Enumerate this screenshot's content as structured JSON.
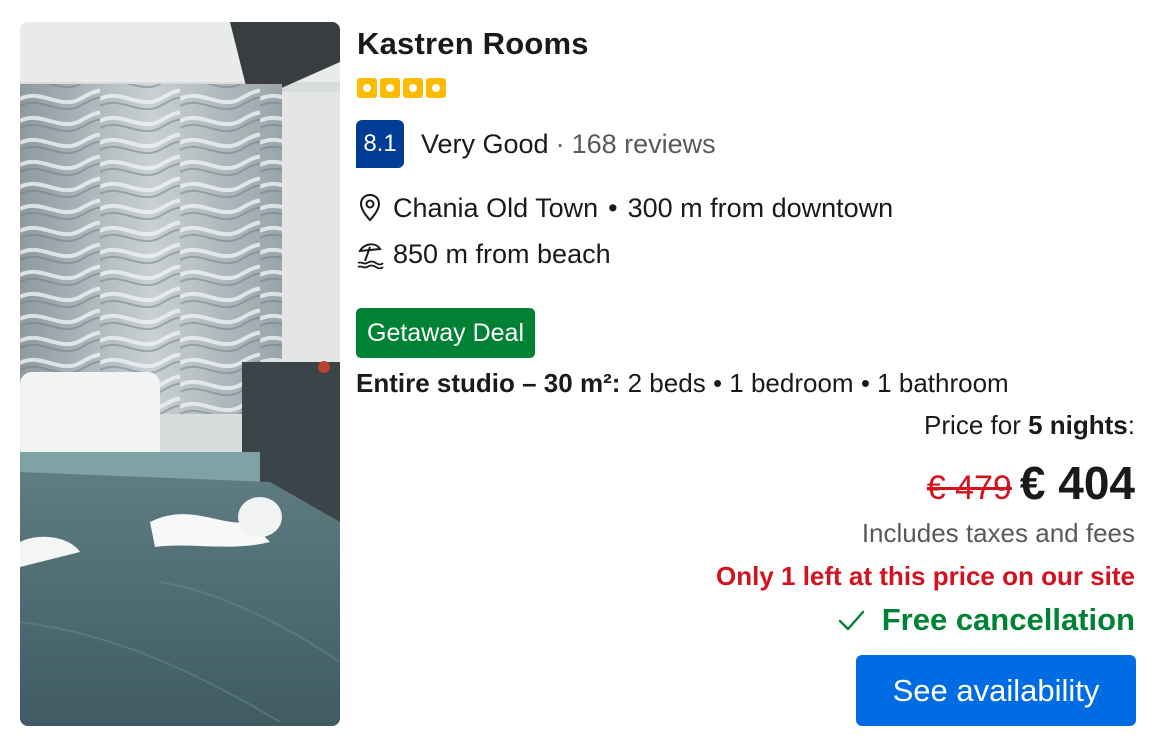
{
  "property": {
    "name": "Kastren Rooms",
    "star_count": 4,
    "stars_color": "#febb02"
  },
  "rating": {
    "score": "8.1",
    "word": "Very Good",
    "separator": "·",
    "reviews": "168 reviews",
    "badge_color": "#003b95"
  },
  "location": {
    "icon": "map-pin-icon",
    "area": "Chania Old Town",
    "separator": "•",
    "distance": "300 m from downtown",
    "beach_icon": "beach-umbrella-icon",
    "beach": "850 m from beach"
  },
  "deal": {
    "label": "Getaway Deal",
    "color": "#008234"
  },
  "unit": {
    "type": "Entire studio – 30 m²:",
    "beds": "2 beds",
    "bedroom": "1 bedroom",
    "bathroom": "1 bathroom",
    "separator": "•"
  },
  "price": {
    "prefix": "Price for",
    "nights": "5 nights",
    "suffix": ":",
    "old": "€ 479",
    "new": "€ 404",
    "taxes": "Includes taxes and fees",
    "scarcity": "Only 1 left at this price on our site",
    "scarcity_color": "#d4111e"
  },
  "cancellation": {
    "icon": "checkmark-icon",
    "label": "Free cancellation"
  },
  "cta": {
    "label": "See availability",
    "color": "#006ce4"
  }
}
